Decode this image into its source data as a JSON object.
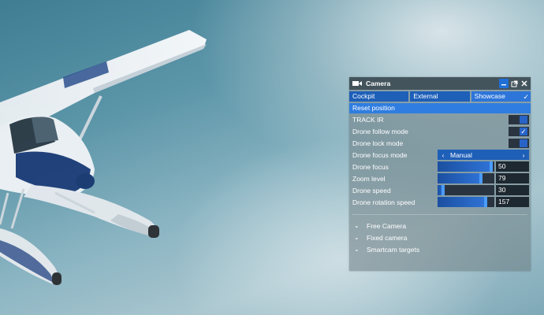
{
  "panel": {
    "title": "Camera",
    "title_icon": "camera-icon",
    "window_buttons": {
      "minimize": "minimize-icon",
      "popout": "popout-icon",
      "close": "close-icon"
    },
    "tabs": [
      {
        "label": "Cockpit",
        "selected": false
      },
      {
        "label": "External",
        "selected": false
      },
      {
        "label": "Showcase",
        "selected": true
      }
    ],
    "reset_label": "Reset position",
    "toggles": [
      {
        "label": "TRACK IR",
        "checked": false
      },
      {
        "label": "Drone follow mode",
        "checked": true
      },
      {
        "label": "Drone lock mode",
        "checked": false
      }
    ],
    "focus_mode": {
      "label": "Drone focus mode",
      "value": "Manual"
    },
    "sliders": [
      {
        "label": "Drone focus",
        "value": "50",
        "fraction": 0.97
      },
      {
        "label": "Zoom level",
        "value": "79",
        "fraction": 0.79
      },
      {
        "label": "Drone speed",
        "value": "30",
        "fraction": 0.12
      },
      {
        "label": "Drone rotation speed",
        "value": "157",
        "fraction": 0.87
      }
    ],
    "sections": [
      {
        "label": "Free Camera"
      },
      {
        "label": "Fixed camera"
      },
      {
        "label": "Smartcam targets"
      }
    ],
    "accent_color": "#2f7de0"
  }
}
